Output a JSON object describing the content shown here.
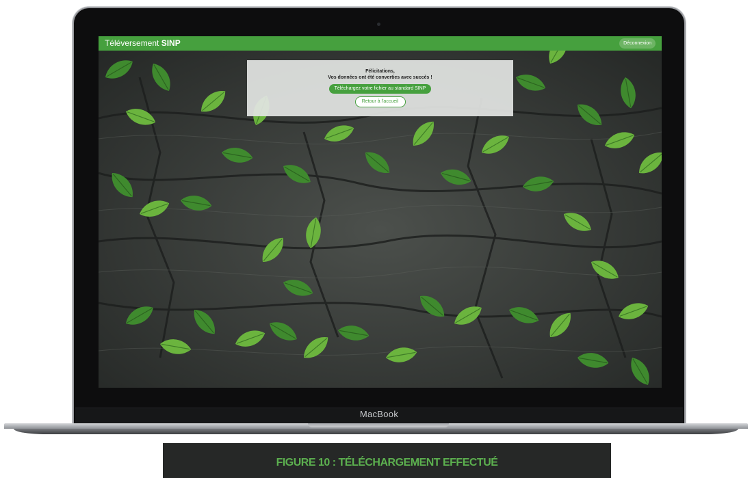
{
  "device": {
    "brand_label": "MacBook"
  },
  "app": {
    "title_prefix": "Téléversement ",
    "title_bold": "SINP",
    "logout_label": "Déconnexion"
  },
  "dialog": {
    "heading_line1": "Félicitations,",
    "heading_line2": "Vos données ont été converties avec succès !",
    "download_label": "Téléchargez votre fichier au standard SINP",
    "home_label": "Retour à l'accueil"
  },
  "caption": {
    "text": "FIGURE 10 : TÉLÉCHARGEMENT EFFECTUÉ"
  },
  "colors": {
    "accent_green": "#46a03e",
    "caption_green": "#5cb04f",
    "caption_bg": "#262827"
  }
}
